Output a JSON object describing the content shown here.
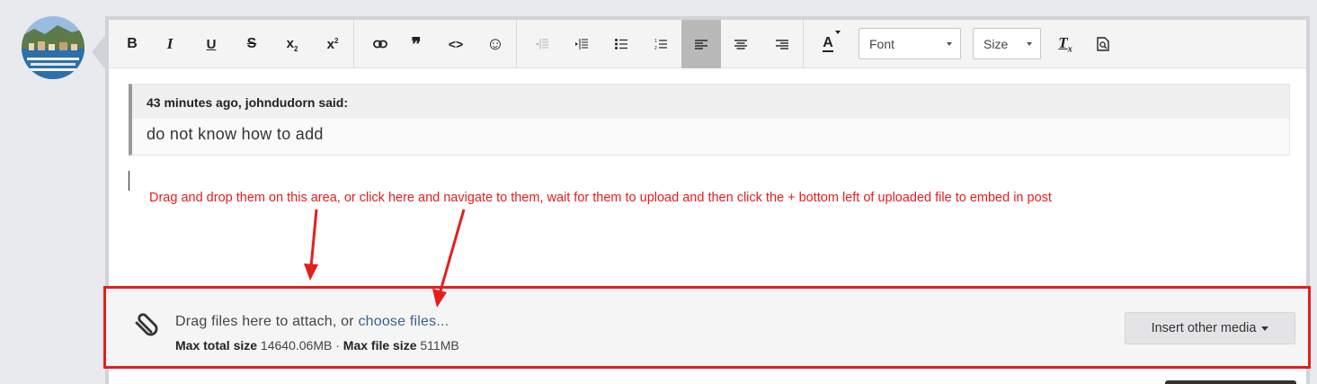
{
  "quote": {
    "citation": "43 minutes ago, johndudorn said:",
    "text": "do not know how to add"
  },
  "annotation": {
    "text": "Drag and drop them on this area, or click here and navigate to them, wait for them to upload and then click the + bottom left of uploaded file to embed in post",
    "color": "#e41e1e"
  },
  "toolbar": {
    "bold": "B",
    "italic": "I",
    "underline": "U",
    "strike": "S",
    "subscript": "x",
    "subscript_mark": "2",
    "superscript": "x",
    "superscript_mark": "2",
    "quote": "❞",
    "code": "<>",
    "emoji": "☺",
    "text_color": "A",
    "font_label": "Font",
    "size_label": "Size",
    "clear_format": "T",
    "clear_format_mark": "x"
  },
  "attach": {
    "prompt": "Drag files here to attach, or ",
    "choose_link": "choose files...",
    "max_total_label": "Max total size",
    "max_total_value": "14640.06MB",
    "separator": "·",
    "max_file_label": "Max file size",
    "max_file_value": "511MB",
    "insert_media_label": "Insert other media"
  }
}
